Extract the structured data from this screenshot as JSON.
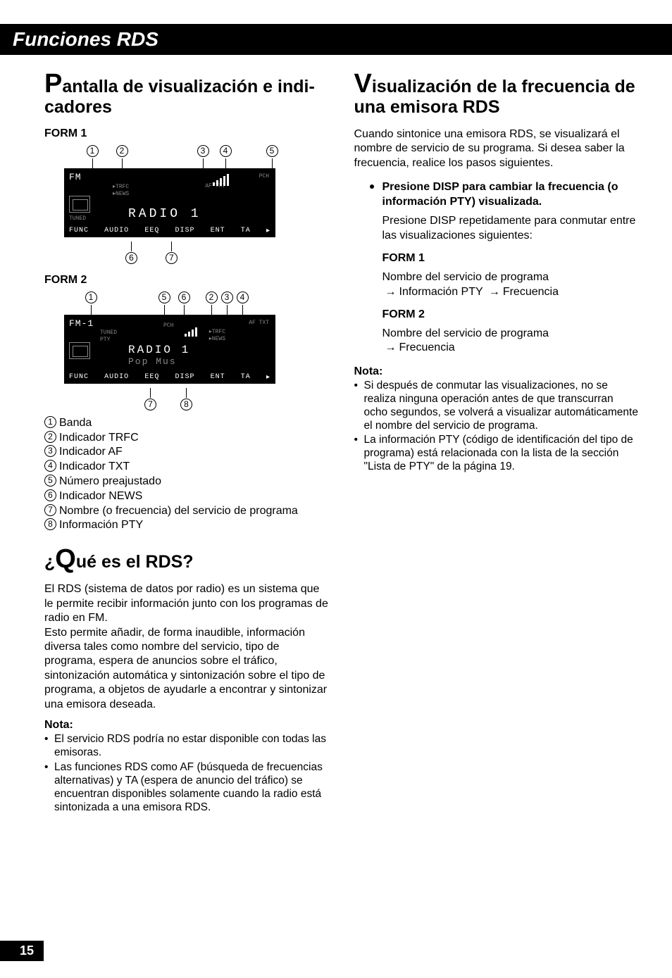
{
  "header": {
    "title": "Funciones RDS"
  },
  "left": {
    "section1_firstletter": "P",
    "section1_rest": "antalla de visualización e indi-cadores",
    "form1_label": "FORM 1",
    "form2_label": "FORM 2",
    "callouts_top_form1": [
      "1",
      "2",
      "3",
      "4",
      "5"
    ],
    "callouts_bottom_form1": [
      "6",
      "7"
    ],
    "callouts_top_form2": [
      "1",
      "5",
      "6",
      "2",
      "3",
      "4"
    ],
    "callouts_bottom_form2": [
      "7",
      "8"
    ],
    "display1": {
      "band": "FM",
      "tuned": "TUNED",
      "main": "RADIO 1",
      "bottom": [
        "FUNC",
        "AUDIO",
        "EEQ",
        "DISP",
        "ENT",
        "TA",
        "▸"
      ],
      "flags": [
        "PCH",
        "AF TXT",
        "▸TRFC",
        "▸NEWS"
      ]
    },
    "display2": {
      "band": "FM-1",
      "tuned": "TUNED",
      "pty": "PTY",
      "main": "RADIO 1",
      "sub": "Pop   Mus",
      "bottom": [
        "FUNC",
        "AUDIO",
        "EEQ",
        "DISP",
        "ENT",
        "TA",
        "▸"
      ],
      "flags": [
        "PCH",
        "AF TXT",
        "▸TRFC",
        "▸NEWS"
      ]
    },
    "legend": [
      "Banda",
      "Indicador TRFC",
      "Indicador AF",
      "Indicador TXT",
      "Número preajustado",
      "Indicador NEWS",
      "Nombre (o frecuencia) del servicio de programa",
      "Información PTY"
    ],
    "section2_prefix": "¿",
    "section2_firstletter": "Q",
    "section2_rest": "ué es el RDS?",
    "rds_para1": "El RDS (sistema de datos por radio) es un sistema que le permite recibir información junto con los programas de radio en FM.",
    "rds_para2": "Esto permite añadir, de forma inaudible, información diversa tales como nombre del servicio, tipo de programa, espera de anuncios sobre el tráfico, sintonización automática y sintonización sobre el tipo de programa, a objetos de ayudarle a encontrar y sintonizar una emisora deseada.",
    "note_label": "Nota:",
    "note_items": [
      "El servicio RDS podría no estar disponible con todas las emisoras.",
      "Las funciones RDS como AF (búsqueda de frecuencias alternativas) y TA (espera de anuncio del tráfico) se encuentran disponibles solamente cuando la radio está sintonizada a una emisora RDS."
    ]
  },
  "right": {
    "section1_firstletter": "V",
    "section1_rest": "isualización de la frecuencia de una emisora RDS",
    "intro": "Cuando sintonice una emisora RDS, se visualizará el nombre de servicio de su programa. Si desea saber la frecuencia, realice los pasos siguientes.",
    "step_bold": "Presione DISP para cambiar la frecuencia (o información PTY) visualizada.",
    "step_text": "Presione DISP repetidamente para conmutar entre las visualizaciones siguientes:",
    "form1_label": "FORM 1",
    "form1_line1": "Nombre del servicio de programa",
    "form1_chain": [
      "Información PTY",
      "Frecuencia"
    ],
    "form2_label": "FORM 2",
    "form2_line1": "Nombre del servicio de programa",
    "form2_chain": [
      "Frecuencia"
    ],
    "note_label": "Nota:",
    "note_items": [
      "Si después de conmutar las visualizaciones, no se realiza ninguna operación antes de que transcurran ocho segundos, se volverá a visualizar automáticamente el nombre del servicio de programa.",
      "La información PTY (código de identificación del tipo de programa) está relacionada con la lista de la sección \"Lista de PTY\" de la página 19."
    ]
  },
  "page_number": "15"
}
